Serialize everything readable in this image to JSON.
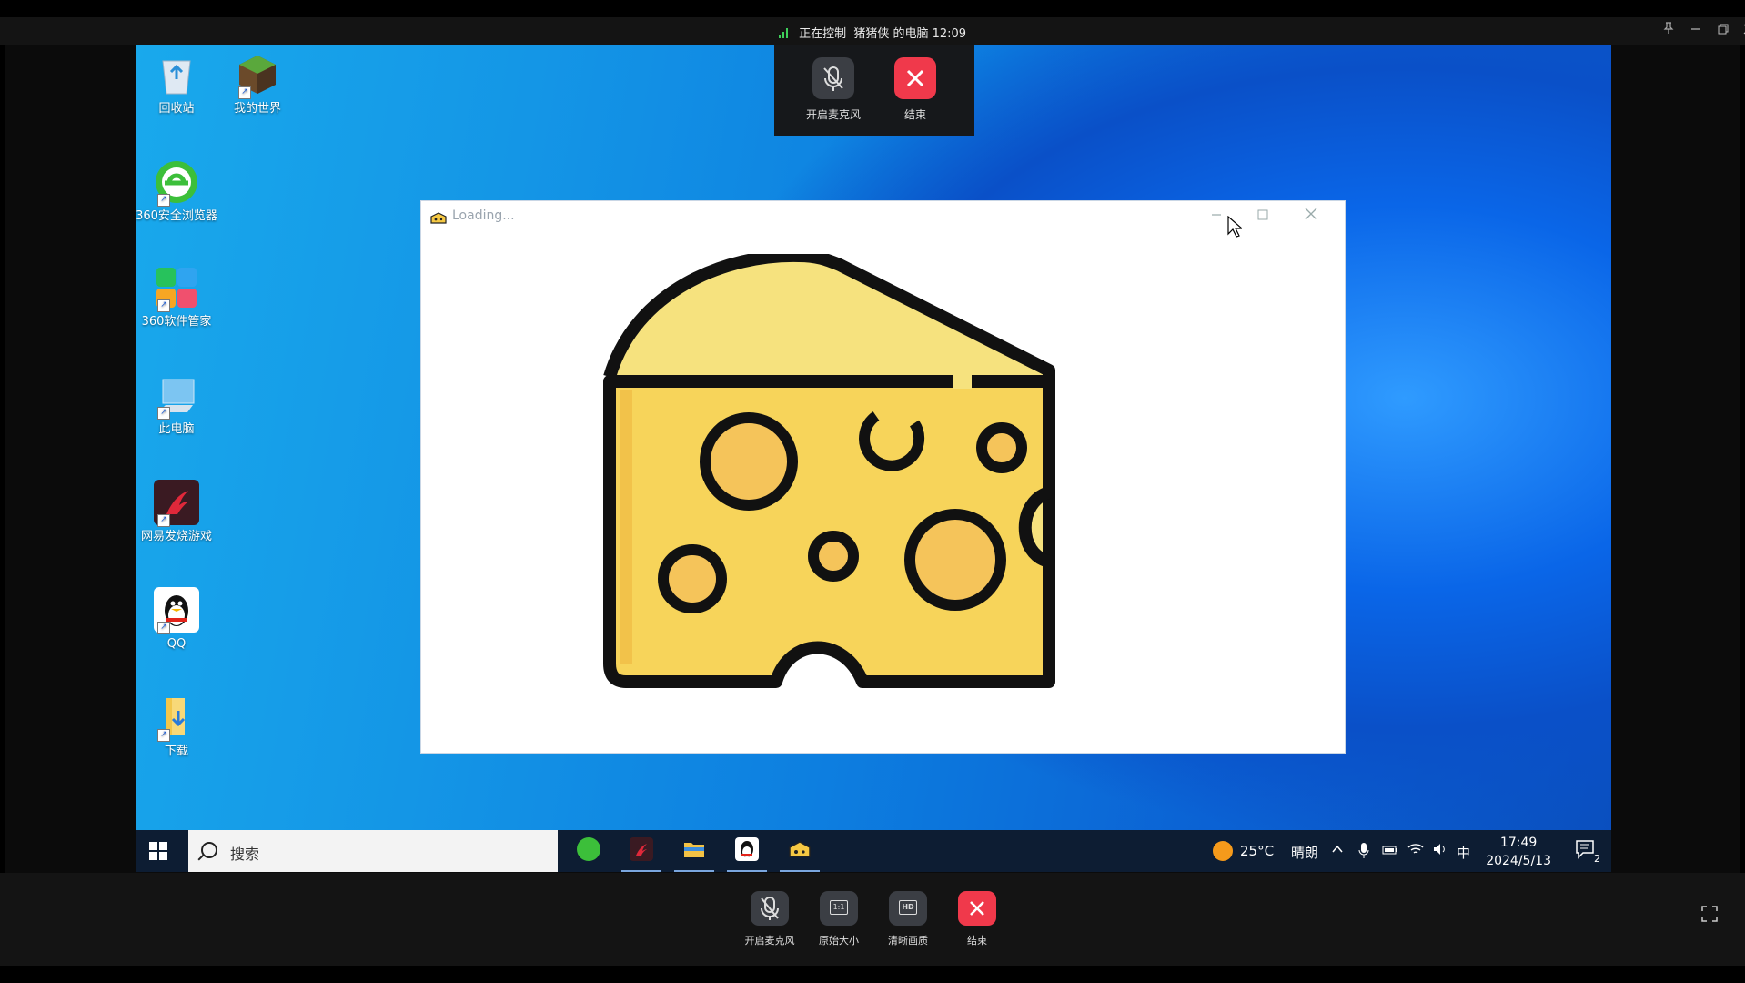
{
  "remote_title": {
    "status": "正在控制",
    "device": "猪猪侠 的电脑 12:09"
  },
  "desktop_icons": [
    {
      "label": "回收站",
      "icon": "recycle-bin-icon"
    },
    {
      "label": "我的世界",
      "icon": "minecraft-icon"
    },
    {
      "label": "360安全浏览器",
      "icon": "browser-360-icon"
    },
    {
      "label": "360软件管家",
      "icon": "software-manager-icon"
    },
    {
      "label": "此电脑",
      "icon": "this-pc-icon"
    },
    {
      "label": "网易发烧游戏",
      "icon": "netease-game-icon"
    },
    {
      "label": "QQ",
      "icon": "qq-icon"
    },
    {
      "label": "下载",
      "icon": "download-folder-icon"
    }
  ],
  "top_overlay": {
    "mic_label": "开启麦克风",
    "end_label": "结束"
  },
  "app_window": {
    "title": "Loading..."
  },
  "taskbar": {
    "search_placeholder": "搜索",
    "weather_temp": "25°C",
    "weather_desc": "晴朗",
    "ime": "中",
    "time": "17:49",
    "date": "2024/5/13",
    "notification_count": "2"
  },
  "bottom_bar": {
    "mic_label": "开启麦克风",
    "original_size_label": "原始大小",
    "hd_label": "清晰画质",
    "end_label": "结束",
    "hd_icon_text": "HD",
    "ratio_icon_text": "1:1"
  },
  "colors": {
    "end_red": "#f0394b",
    "cheese_yellow": "#f7d45a",
    "cheese_top": "#f6e27e",
    "taskbar_bg": "#0d1d33"
  }
}
